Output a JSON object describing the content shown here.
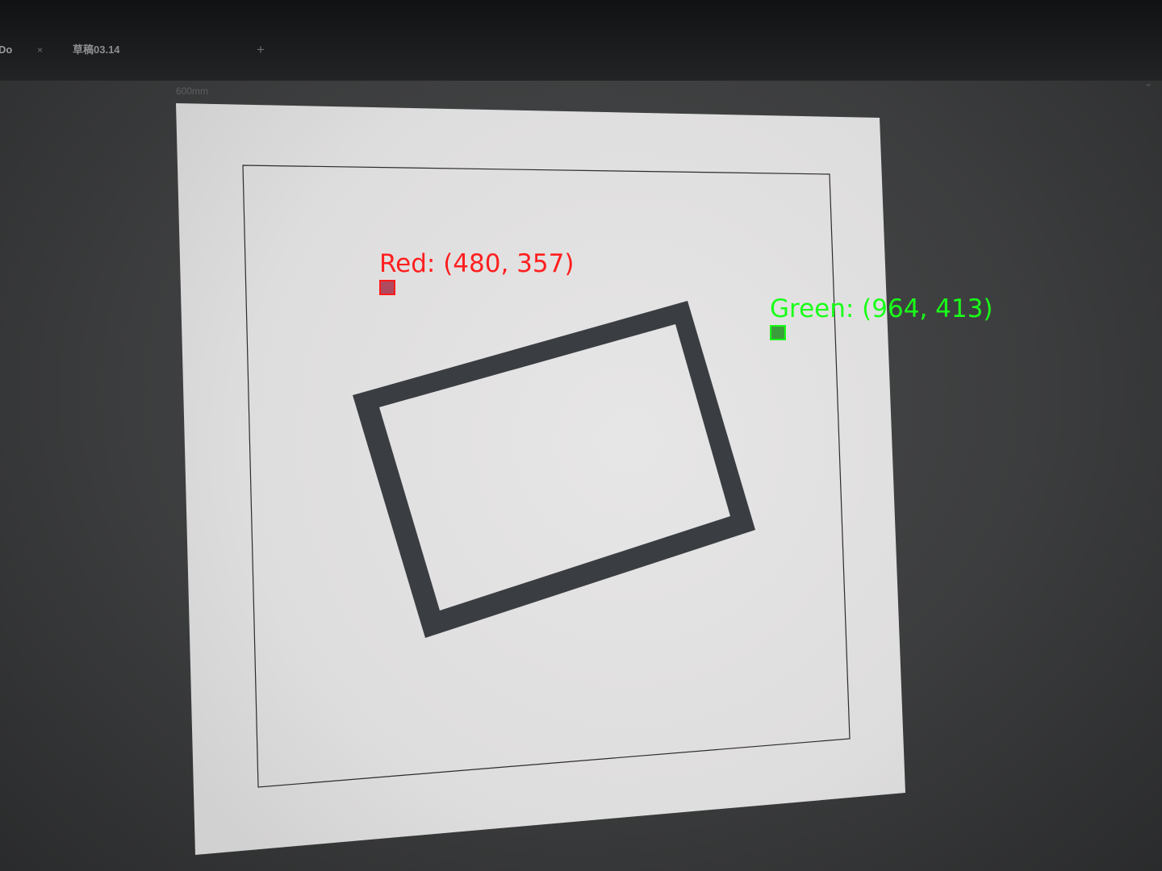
{
  "tabs": {
    "first_label": "Do",
    "close_glyph": "×",
    "second_label": "草稿03.14",
    "new_tab_glyph": "+"
  },
  "canvas": {
    "ruler_label": "600mm",
    "expand_glyph": "⌄"
  },
  "markers": {
    "red": {
      "label": "Red: (480, 357)",
      "color": "#ff1f1f"
    },
    "green": {
      "label": "Green: (964, 413)",
      "color": "#19ff19"
    }
  },
  "colors": {
    "artboard": "#e4e3e3",
    "shape_stroke": "#3a3d42",
    "app_background": "#3c3d3e"
  }
}
